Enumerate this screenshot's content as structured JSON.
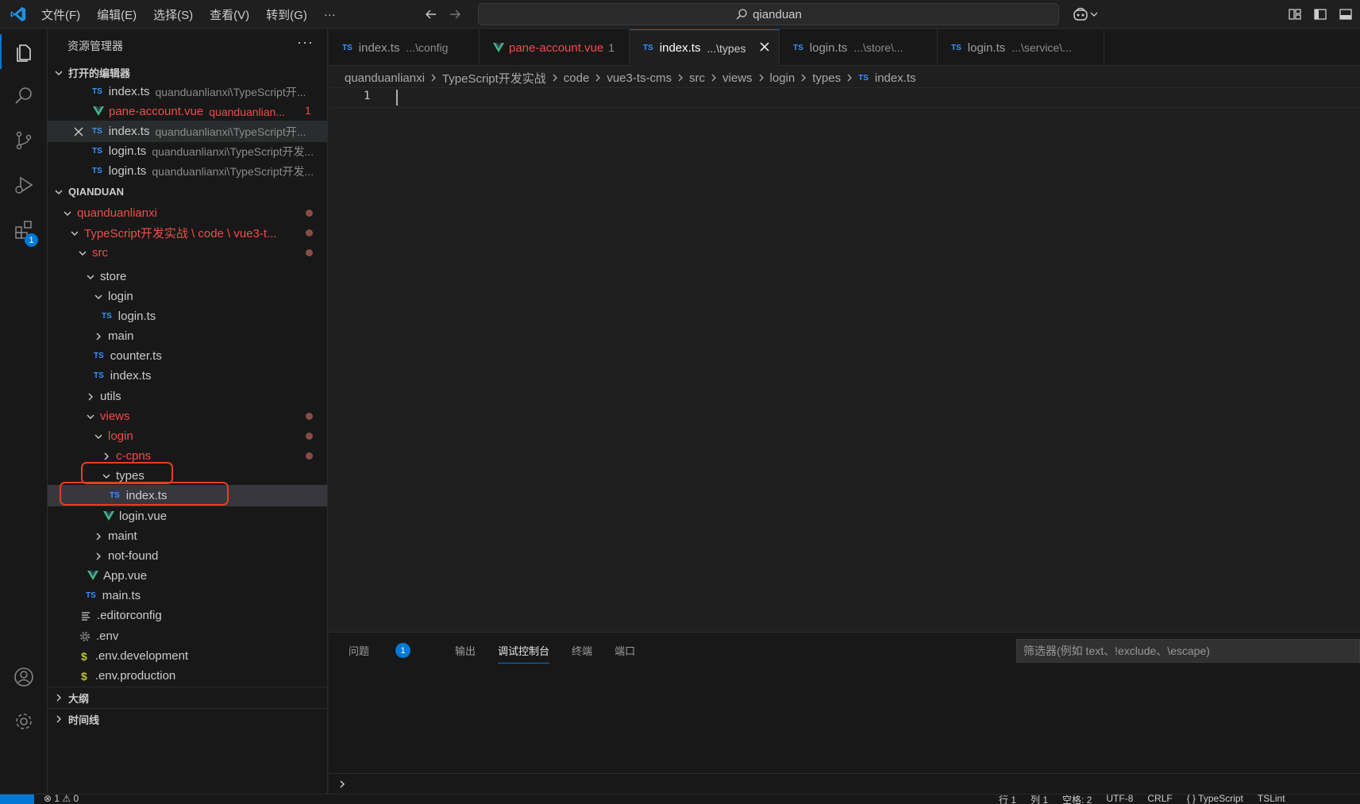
{
  "menu": [
    "文件(F)",
    "编辑(E)",
    "选择(S)",
    "查看(V)",
    "转到(G)",
    "···"
  ],
  "search": {
    "text": "qianduan"
  },
  "activity": {
    "extensions_badge": "1"
  },
  "sidebar": {
    "title": "资源管理器",
    "more": "···",
    "open_editors": {
      "header": "打开的编辑器",
      "items": [
        {
          "icon": "TS",
          "name": "index.ts",
          "desc": "quanduanlianxi\\TypeScript开..."
        },
        {
          "icon": "VUE",
          "name": "pane-account.vue",
          "desc": "quanduanlian...",
          "problems": "1"
        },
        {
          "icon": "TS",
          "name": "index.ts",
          "desc": "quanduanlianxi\\TypeScript开..."
        },
        {
          "icon": "TS",
          "name": "login.ts",
          "desc": "quanduanlianxi\\TypeScript开发..."
        },
        {
          "icon": "TS",
          "name": "login.ts",
          "desc": "quanduanlianxi\\TypeScript开发..."
        }
      ]
    },
    "workspace": {
      "header": "QIANDUAN",
      "tree": [
        {
          "label": "quanduanlianxi",
          "folder": true,
          "open": true
        },
        {
          "label": "TypeScript开发实战 \\ code \\ vue3-t...",
          "folder": true,
          "open": true
        },
        {
          "label": "src",
          "folder": true,
          "open": true
        },
        {
          "label": "store",
          "folder": true,
          "open": true
        },
        {
          "label": "login",
          "folder": true,
          "open": true
        },
        {
          "label": "login.ts"
        },
        {
          "label": "main",
          "folder": true,
          "open": false
        },
        {
          "label": "counter.ts"
        },
        {
          "label": "index.ts"
        },
        {
          "label": "utils",
          "folder": true,
          "open": false
        },
        {
          "label": "views",
          "folder": true,
          "open": true
        },
        {
          "label": "login",
          "folder": true,
          "open": true
        },
        {
          "label": "c-cpns",
          "folder": true,
          "open": false
        },
        {
          "label": "types",
          "folder": true,
          "open": true
        },
        {
          "label": "index.ts"
        },
        {
          "label": "login.vue"
        },
        {
          "label": "maint",
          "folder": true,
          "open": false
        },
        {
          "label": "not-found",
          "folder": true,
          "open": false
        },
        {
          "label": "App.vue"
        },
        {
          "label": "main.ts"
        },
        {
          "label": ".editorconfig"
        },
        {
          "label": ".env"
        },
        {
          "label": ".env.development"
        },
        {
          "label": ".env.production"
        }
      ]
    },
    "outline": "大纲",
    "timeline": "时间线"
  },
  "tabs": [
    {
      "icon": "TS",
      "name": "index.ts",
      "desc": "...\\config"
    },
    {
      "icon": "VUE",
      "name": "pane-account.vue",
      "desc": "1"
    },
    {
      "icon": "TS",
      "name": "index.ts",
      "desc": "...\\types"
    },
    {
      "icon": "TS",
      "name": "login.ts",
      "desc": "...\\store\\..."
    },
    {
      "icon": "TS",
      "name": "login.ts",
      "desc": "...\\service\\..."
    }
  ],
  "breadcrumb": [
    "quanduanlianxi",
    "TypeScript开发实战",
    "code",
    "vue3-ts-cms",
    "src",
    "views",
    "login",
    "types",
    "index.ts"
  ],
  "editor": {
    "line_number": "1"
  },
  "panel": {
    "tabs": [
      "问题",
      "输出",
      "调试控制台",
      "终端",
      "端口"
    ],
    "problems_badge": "1",
    "filter_placeholder": "筛选器(例如 text、!exclude、\\escape)"
  },
  "statusbar": {
    "left": "⊗ 1 ⚠ 0",
    "line": "行 1",
    "col": "列 1",
    "spaces": "空格: 2",
    "encoding": "UTF-8",
    "eol": "CRLF",
    "language": "{ } TypeScript",
    "tslint": "TSLint"
  },
  "colors": {
    "accent": "#0078d4",
    "modified": "#f14c4c",
    "ts": "#3794ff",
    "vue": "#41b883",
    "highlight_box": "#e0401f"
  }
}
